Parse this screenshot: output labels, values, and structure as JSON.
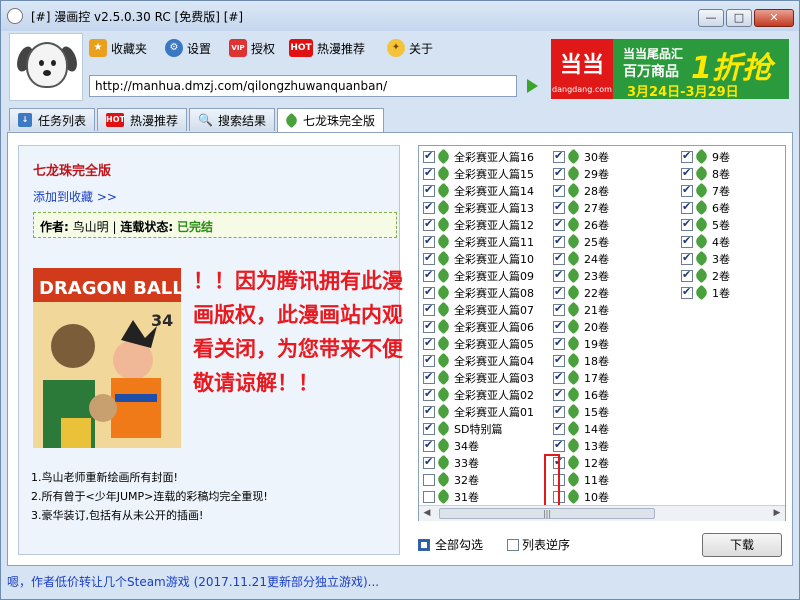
{
  "window": {
    "title": "[#] 漫画控 v2.5.0.30 RC [免费版] [#]",
    "min_glyph": "—",
    "max_glyph": "□",
    "close_glyph": "✕"
  },
  "toolbar": {
    "favorites": "收藏夹",
    "settings": "设置",
    "license": "授权",
    "hot": "热漫推荐",
    "about": "关于",
    "vip_badge": "VIP",
    "hot_badge": "HOT"
  },
  "url": "http://manhua.dmzj.com/qilongzhuwanquanban/",
  "ad": {
    "logo": "当当",
    "logo_sub": "dangdang.com",
    "line1": "当当尾品汇",
    "line2": "百万商品",
    "big": "1折抢",
    "dates": "3月24日-3月29日"
  },
  "tabs": [
    {
      "label": "任务列表"
    },
    {
      "label": "热漫推荐"
    },
    {
      "label": "搜索结果"
    },
    {
      "label": "七龙珠完全版"
    }
  ],
  "book": {
    "title": "七龙珠完全版",
    "add_fav": "添加到收藏 >>",
    "author_label": "作者:",
    "author": "鸟山明",
    "status_label": "连载状态:",
    "status": "已完结",
    "cover_text": "DRAGON BALL",
    "cover_num": "34",
    "notice": "！！因为腾讯拥有此漫画版权，此漫画站内观看关闭，为您带来不便敬请谅解！！",
    "features": [
      "1.鸟山老师重新绘画所有封面!",
      "2.所有曾于<少年JUMP>连载的彩稿均完全重现!",
      "3.豪华装订,包括有从未公开的插画!"
    ]
  },
  "chapters": {
    "col1": [
      {
        "label": "全彩赛亚人篇16",
        "checked": true
      },
      {
        "label": "全彩赛亚人篇15",
        "checked": true
      },
      {
        "label": "全彩赛亚人篇14",
        "checked": true
      },
      {
        "label": "全彩赛亚人篇13",
        "checked": true
      },
      {
        "label": "全彩赛亚人篇12",
        "checked": true
      },
      {
        "label": "全彩赛亚人篇11",
        "checked": true
      },
      {
        "label": "全彩赛亚人篇10",
        "checked": true
      },
      {
        "label": "全彩赛亚人篇09",
        "checked": true
      },
      {
        "label": "全彩赛亚人篇08",
        "checked": true
      },
      {
        "label": "全彩赛亚人篇07",
        "checked": true
      },
      {
        "label": "全彩赛亚人篇06",
        "checked": true
      },
      {
        "label": "全彩赛亚人篇05",
        "checked": true
      },
      {
        "label": "全彩赛亚人篇04",
        "checked": true
      },
      {
        "label": "全彩赛亚人篇03",
        "checked": true
      },
      {
        "label": "全彩赛亚人篇02",
        "checked": true
      },
      {
        "label": "全彩赛亚人篇01",
        "checked": true
      },
      {
        "label": "SD特别篇",
        "checked": true
      },
      {
        "label": "34卷",
        "checked": true
      },
      {
        "label": "33卷",
        "checked": true
      },
      {
        "label": "32卷",
        "checked": false
      },
      {
        "label": "31卷",
        "checked": false
      }
    ],
    "col2": [
      {
        "label": "30卷",
        "checked": true
      },
      {
        "label": "29卷",
        "checked": true
      },
      {
        "label": "28卷",
        "checked": true
      },
      {
        "label": "27卷",
        "checked": true
      },
      {
        "label": "26卷",
        "checked": true
      },
      {
        "label": "25卷",
        "checked": true
      },
      {
        "label": "24卷",
        "checked": true
      },
      {
        "label": "23卷",
        "checked": true
      },
      {
        "label": "22卷",
        "checked": true
      },
      {
        "label": "21卷",
        "checked": true
      },
      {
        "label": "20卷",
        "checked": true
      },
      {
        "label": "19卷",
        "checked": true
      },
      {
        "label": "18卷",
        "checked": true
      },
      {
        "label": "17卷",
        "checked": true
      },
      {
        "label": "16卷",
        "checked": true
      },
      {
        "label": "15卷",
        "checked": true
      },
      {
        "label": "14卷",
        "checked": true
      },
      {
        "label": "13卷",
        "checked": true
      },
      {
        "label": "12卷",
        "checked": true
      },
      {
        "label": "11卷",
        "checked": false
      },
      {
        "label": "10卷",
        "checked": false
      }
    ],
    "col3": [
      {
        "label": "9卷",
        "checked": true
      },
      {
        "label": "8卷",
        "checked": true
      },
      {
        "label": "7卷",
        "checked": true
      },
      {
        "label": "6卷",
        "checked": true
      },
      {
        "label": "5卷",
        "checked": true
      },
      {
        "label": "4卷",
        "checked": true
      },
      {
        "label": "3卷",
        "checked": true
      },
      {
        "label": "2卷",
        "checked": true
      },
      {
        "label": "1卷",
        "checked": true
      }
    ]
  },
  "options": {
    "select_all": "全部勾选",
    "reverse": "列表逆序",
    "download": "下载"
  },
  "status": "嗯，作者低价转让几个Steam游戏 (2017.11.21更新部分独立游戏)..."
}
